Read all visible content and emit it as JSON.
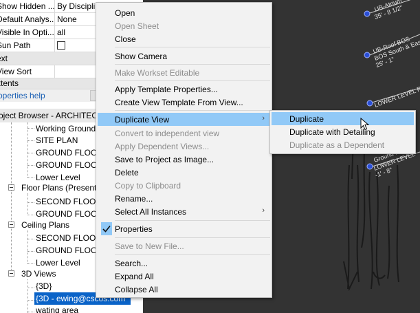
{
  "properties": {
    "rows": [
      {
        "name": "Show Hidden ...",
        "value": "By Discipli"
      },
      {
        "name": "Default Analys...",
        "value": "None"
      },
      {
        "name": "Visible In Opti...",
        "value": "all"
      },
      {
        "name": "Sun Path",
        "value": ""
      }
    ],
    "group_text": "ext",
    "view_sort": "View Sort",
    "group_extents": "xtents",
    "help_link": "roperties help"
  },
  "browser": {
    "title": "oject Browser - ARCHITECT",
    "nodes": [
      {
        "label": "Working Ground"
      },
      {
        "label": "SITE PLAN"
      },
      {
        "label": "GROUND FLOOR"
      },
      {
        "label": "GROUND FLOOR"
      },
      {
        "label": "Lower Level"
      },
      {
        "label": "Floor Plans (Presentat"
      },
      {
        "label": "SECOND FLOOR"
      },
      {
        "label": "GROUND FLOOR"
      },
      {
        "label": "Ceiling Plans"
      },
      {
        "label": "SECOND FLOOR"
      },
      {
        "label": "GROUND FLOOR"
      },
      {
        "label": "Lower Level"
      },
      {
        "label": "3D Views"
      },
      {
        "label": "{3D}"
      },
      {
        "label": "{3D - ewing@cscos.com"
      },
      {
        "label": "wating area"
      }
    ]
  },
  "canvas": {
    "labels": [
      "UB-Atrium",
      "35' - 8 1/2\"",
      "UB-Roof BOS",
      "BOS South & East A",
      "25' - 1\"",
      "LOWER LEVEL ROO",
      "Ground Fl",
      "LOWER LEVEL",
      "-1' - 8\""
    ]
  },
  "context_menu": {
    "items": [
      {
        "label": "Open",
        "enabled": true
      },
      {
        "label": "Open Sheet",
        "enabled": false
      },
      {
        "label": "Close",
        "enabled": true
      },
      {
        "label": "Show Camera",
        "enabled": true
      },
      {
        "label": "Make Workset Editable",
        "enabled": false
      },
      {
        "label": "Apply Template Properties...",
        "enabled": true
      },
      {
        "label": "Create View Template From View...",
        "enabled": true
      },
      {
        "label": "Duplicate View",
        "enabled": true
      },
      {
        "label": "Convert to independent view",
        "enabled": false
      },
      {
        "label": "Apply Dependent Views...",
        "enabled": false
      },
      {
        "label": "Save to Project as Image...",
        "enabled": true
      },
      {
        "label": "Delete",
        "enabled": true
      },
      {
        "label": "Copy to Clipboard",
        "enabled": false
      },
      {
        "label": "Rename...",
        "enabled": true
      },
      {
        "label": "Select All Instances",
        "enabled": true
      },
      {
        "label": "Properties",
        "enabled": true,
        "checked": true
      },
      {
        "label": "Save to New File...",
        "enabled": false
      },
      {
        "label": "Search...",
        "enabled": true
      },
      {
        "label": "Expand All",
        "enabled": true
      },
      {
        "label": "Collapse All",
        "enabled": true
      }
    ]
  },
  "submenu": {
    "items": [
      {
        "label": "Duplicate",
        "enabled": true
      },
      {
        "label": "Duplicate with Detailing",
        "enabled": true
      },
      {
        "label": "Duplicate as a Dependent",
        "enabled": false
      }
    ]
  },
  "colors": {
    "highlight": "#91c9f7",
    "selection": "#0a63c8",
    "canvas_bg": "#333333",
    "level_marker": "#2a4fd6",
    "check_box": "#91c9f7"
  }
}
